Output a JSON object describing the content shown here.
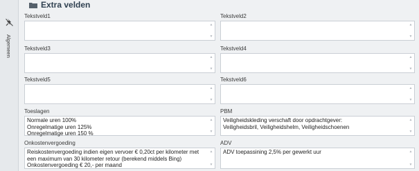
{
  "sidebar": {
    "pin_icon": "pin-icon",
    "label": "Algemeen"
  },
  "header": {
    "icon": "folder-icon",
    "title": "Extra velden"
  },
  "fields": [
    {
      "label": "Tekstveld1",
      "lines": []
    },
    {
      "label": "Tekstveld2",
      "lines": []
    },
    {
      "label": "Tekstveld3",
      "lines": []
    },
    {
      "label": "Tekstveld4",
      "lines": []
    },
    {
      "label": "Tekstveld5",
      "lines": []
    },
    {
      "label": "Tekstveld6",
      "lines": []
    },
    {
      "label": "Toeslagen",
      "lines": [
        "Normale uren 100%",
        "Onregelmatige uren 125%",
        "Onregelmatige uren 150 %"
      ]
    },
    {
      "label": "PBM",
      "lines": [
        "Veiligheidskleding verschaft door opdrachtgever:",
        "Veiligheidsbril, Veiligheidshelm, Veiligheidschoenen"
      ]
    },
    {
      "label": "Onkostenvergoeding",
      "lines": [
        "Reiskostenvergoeding indien eigen vervoer € 0,20ct per kilometer met",
        "een maximum van 30 kilometer retour (berekend middels Bing)",
        "Onkostenvergoeding € 20,- per maand"
      ]
    },
    {
      "label": "ADV",
      "lines": [
        "ADV toepassining 2,5% per gewerkt uur"
      ]
    }
  ]
}
